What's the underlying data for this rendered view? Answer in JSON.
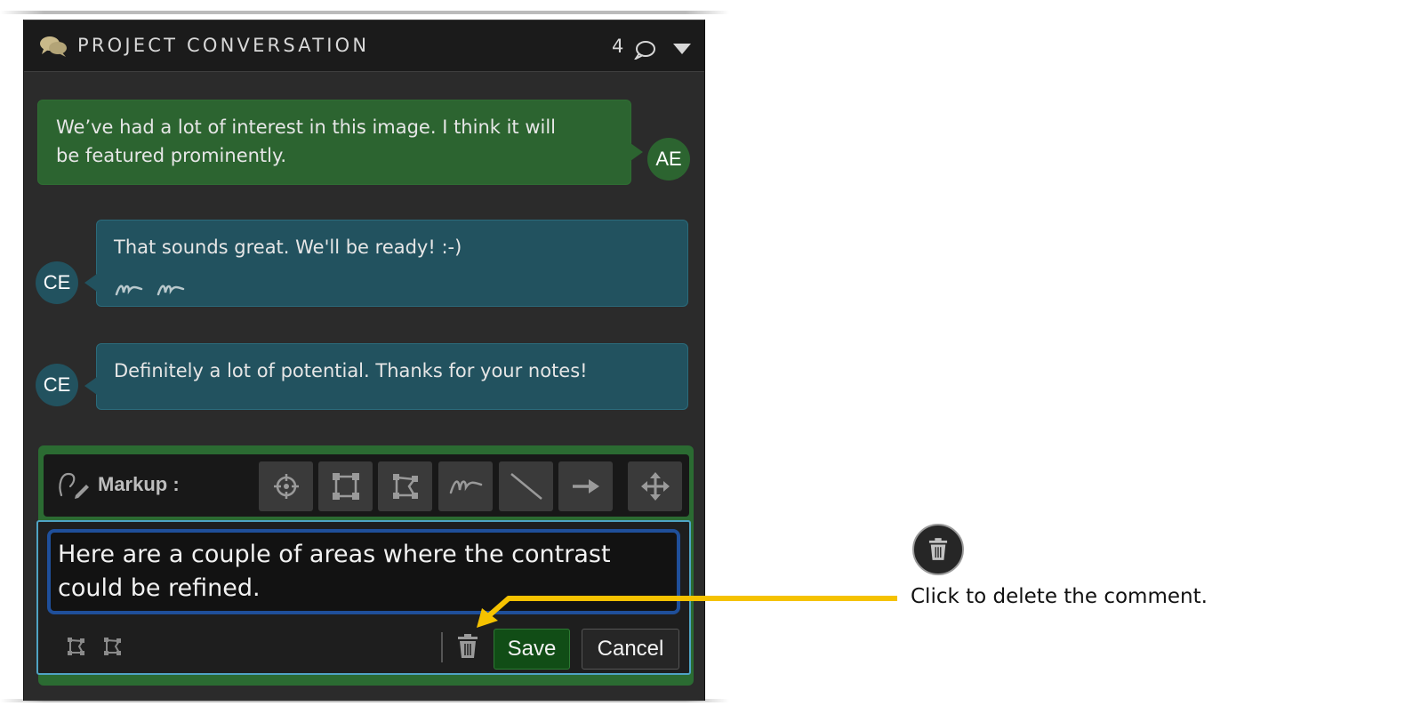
{
  "header": {
    "title": "PROJECT CONVERSATION",
    "comment_count": "4",
    "icons": {
      "chat": "chat-bubbles-icon",
      "count": "speech-bubble-icon",
      "collapse": "caret-down-icon"
    }
  },
  "messages": [
    {
      "text_line1": "We’ve had a lot of interest in this image. I think it will",
      "text_line2": "be featured prominently.",
      "author": "AE",
      "side": "right",
      "color": "#2c6430"
    },
    {
      "text": "That sounds great. We'll be ready! :-)",
      "author": "CE",
      "side": "left",
      "color": "#22525f",
      "attachments": [
        "freehand-icon",
        "freehand-icon"
      ]
    },
    {
      "text": "Definitely a lot of potential. Thanks for your notes!",
      "author": "CE",
      "side": "left",
      "color": "#22525f"
    }
  ],
  "compose": {
    "markup_label": "Markup :",
    "tools": [
      "crosshair-icon",
      "rectangle-icon",
      "polygon-icon",
      "freehand-icon",
      "line-icon",
      "arrow-icon",
      "move-icon"
    ],
    "text": "Here are a couple of areas where the contrast could be refined.",
    "attached_markups": [
      "polygon-icon",
      "polygon-icon"
    ],
    "save_label": "Save",
    "cancel_label": "Cancel",
    "delete_icon": "trash-icon"
  },
  "callout": {
    "text": "Click to delete the comment.",
    "icon": "trash-icon",
    "arrow_color": "#f5c200"
  }
}
